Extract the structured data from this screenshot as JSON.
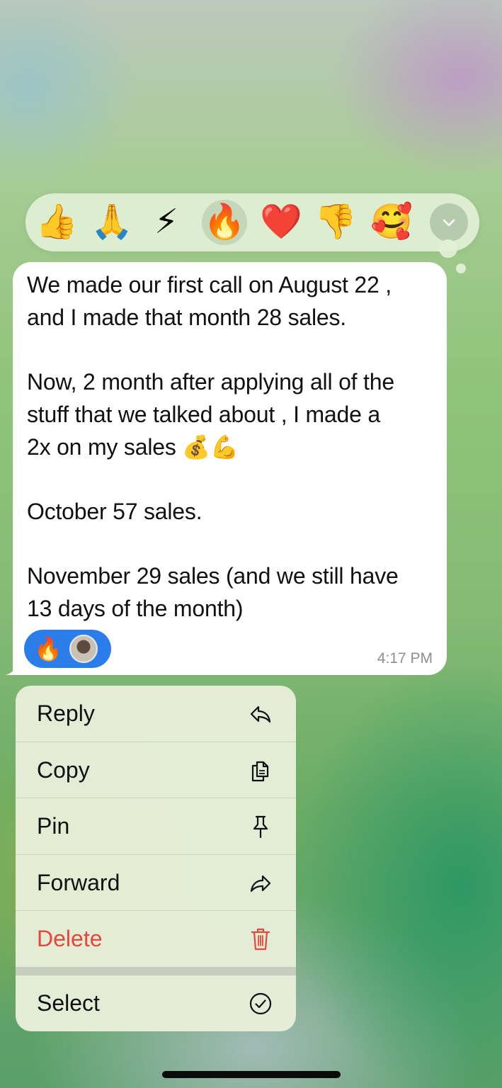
{
  "reactions": [
    {
      "name": "thumbs-up",
      "emoji": "👍"
    },
    {
      "name": "folded-hands",
      "emoji": "🙏"
    },
    {
      "name": "high-voltage",
      "emoji": "⚡"
    },
    {
      "name": "fire",
      "emoji": "🔥",
      "selected": true
    },
    {
      "name": "red-heart",
      "emoji": "❤️"
    },
    {
      "name": "thumbs-down",
      "emoji": "👎"
    },
    {
      "name": "smiling-face-with-hearts",
      "emoji": "🥰"
    }
  ],
  "message": {
    "text": "We made our first call on August 22 ,\nand I made that month 28 sales.\n\nNow, 2 month after applying all of the\nstuff that we talked about , I made a\n2x on my sales 💰💪\n\nOctober 57 sales.\n\nNovember 29 sales (and we still have\n13 days of the month)",
    "reaction_emoji": "🔥",
    "time": "4:17 PM"
  },
  "menu": {
    "reply": "Reply",
    "copy": "Copy",
    "pin": "Pin",
    "forward": "Forward",
    "delete": "Delete",
    "select": "Select"
  },
  "colors": {
    "accent": "#2b7dea",
    "danger": "#e5473e",
    "bubble": "#ffffff",
    "menu_bg": "#e8eeda"
  }
}
